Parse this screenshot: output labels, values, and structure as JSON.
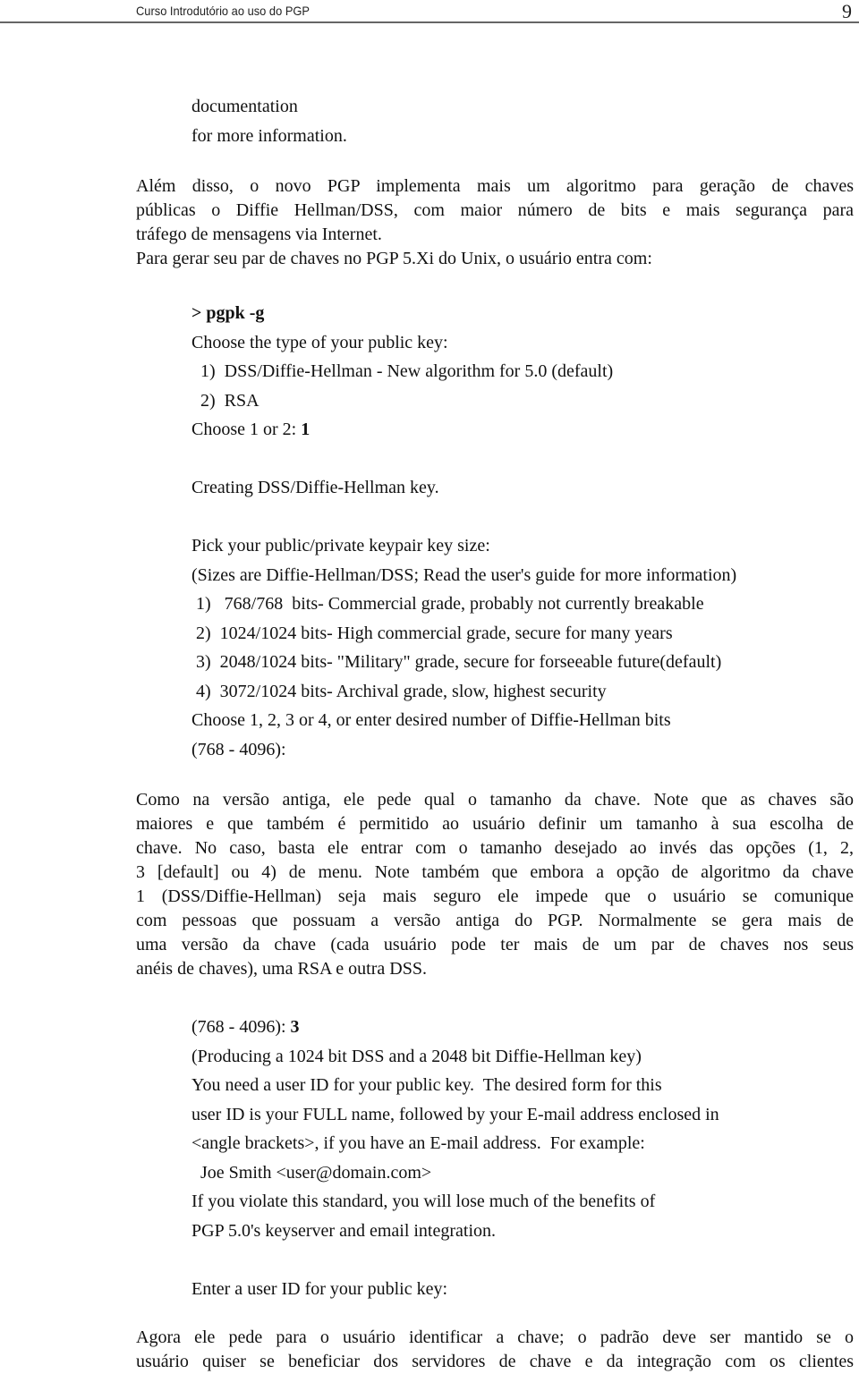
{
  "header": {
    "title": "Curso Introdutório ao uso do PGP",
    "page_number": "9"
  },
  "intro_terminal": {
    "lines": [
      "documentation",
      "for more information."
    ]
  },
  "paragraph_1": {
    "lines": [
      "Além disso, o novo PGP implementa mais um algoritmo para geração de chaves",
      "públicas o Diffie Hellman/DSS, com maior número de bits e mais segurança para",
      "tráfego de mensagens via Internet.",
      "Para gerar seu par de chaves no PGP 5.Xi do Unix, o usuário entra com:"
    ]
  },
  "terminal_1": {
    "command": "> pgpk -g",
    "prompt_type": "Choose the type of your public key:",
    "options": [
      "  1)  DSS/Diffie-Hellman - New algorithm for 5.0 (default)",
      "  2)  RSA"
    ],
    "choose_prompt": "Choose 1 or 2: ",
    "choose_value": "1",
    "creating": "Creating DSS/Diffie-Hellman key."
  },
  "terminal_2": {
    "title": "Pick your public/private keypair key size:",
    "note": "(Sizes are Diffie-Hellman/DSS; Read the user's guide for more information)",
    "options": [
      " 1)   768/768  bits- Commercial grade, probably not currently breakable",
      " 2)  1024/1024 bits- High commercial grade, secure for many years",
      " 3)  2048/1024 bits- \"Military\" grade, secure for forseeable future(default)",
      " 4)  3072/1024 bits- Archival grade, slow, highest security"
    ],
    "choose": "Choose 1, 2, 3 or 4, or enter desired number of Diffie-Hellman bits",
    "range": "(768 - 4096):"
  },
  "paragraph_2": {
    "lines": [
      "Como na versão antiga, ele pede qual o tamanho da chave. Note que as chaves são",
      "maiores e que também é permitido ao usuário definir um tamanho à sua escolha de",
      "chave. No caso, basta ele entrar com o tamanho desejado ao invés das opções (1, 2,",
      "3 [default] ou 4) de menu. Note também que embora a opção de algoritmo da chave",
      "1 (DSS/Diffie-Hellman) seja mais seguro ele impede que o usuário se comunique",
      "com pessoas que possuam a versão antiga do PGP. Normalmente se gera mais de",
      "uma versão da chave (cada usuário pode ter mais de um par de chaves nos seus",
      "anéis de chaves), uma RSA e outra DSS."
    ]
  },
  "terminal_3": {
    "range_prompt": "(768 - 4096): ",
    "range_value": "3",
    "lines": [
      "(Producing a 1024 bit DSS and a 2048 bit Diffie-Hellman key)",
      "You need a user ID for your public key.  The desired form for this",
      "user ID is your FULL name, followed by your E-mail address enclosed in",
      "<angle brackets>, if you have an E-mail address.  For example:",
      "  Joe Smith <user@domain.com>",
      "If you violate this standard, you will lose much of the benefits of",
      "PGP 5.0's keyserver and email integration."
    ],
    "enter_prompt": "Enter a user ID for your public key:"
  },
  "paragraph_3": {
    "lines": [
      "Agora ele pede para o usuário identificar a chave; o padrão deve ser mantido se o",
      "usuário quiser se beneficiar dos servidores de chave e da integração com os clientes"
    ]
  }
}
